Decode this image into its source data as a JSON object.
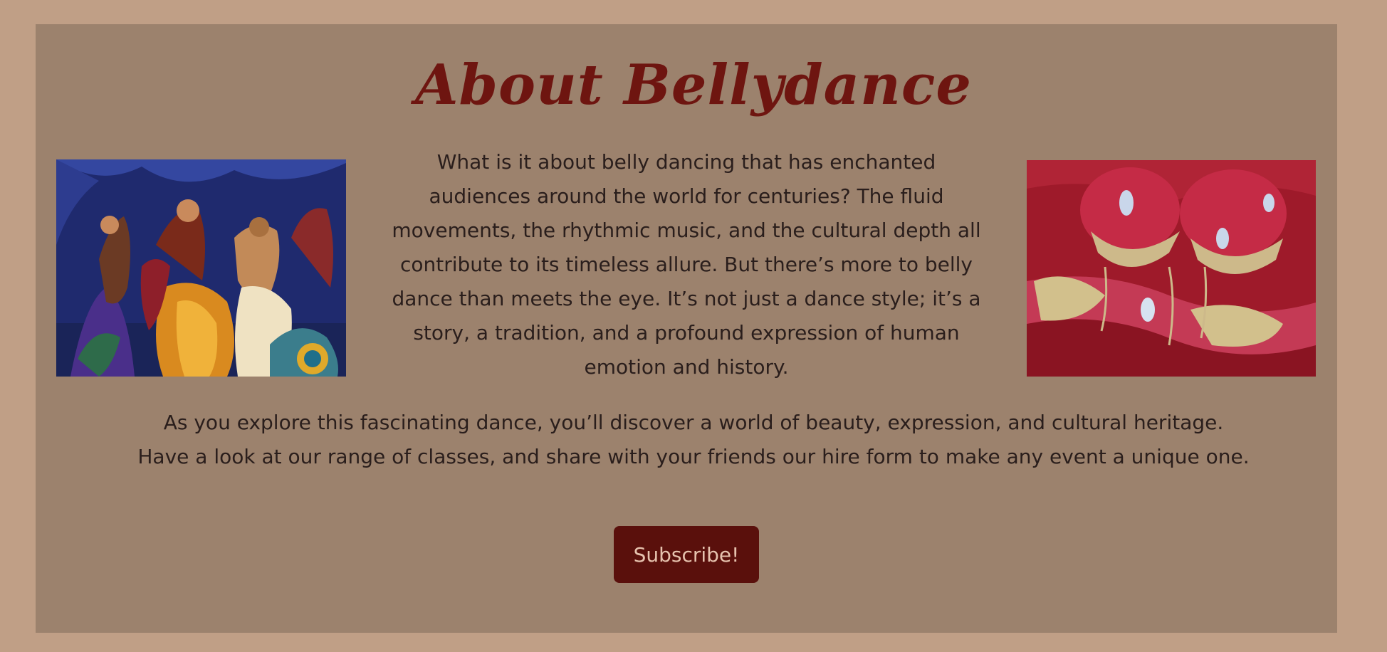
{
  "page": {
    "title": "About Bellydance",
    "intro_text": "What is it about belly dancing that has enchanted audiences around the world for centuries? The fluid movements, the rhythmic music, and the cultural depth all contribute to its timeless allure. But there’s more to belly dance than meets the eye. It’s not just a dance style; it’s a story, a tradition, and a profound expression of human emotion and history.",
    "outro_line1": "As you explore this fascinating dance, you’ll discover a world of beauty, expression, and cultural heritage.",
    "outro_line2": "Have a look at our range of classes, and share with your friends our hire form to make any event a unique one.",
    "subscribe_label": "Subscribe!"
  },
  "images": {
    "left": "painting of belly dancers",
    "right": "red jeweled belly dance costume"
  },
  "colors": {
    "outer_background": "#c09f86",
    "panel_background": "#9c826d",
    "title": "#6e1510",
    "body_text": "#2a1e1c",
    "button_background": "#5a100c",
    "button_text": "#e6c2ae"
  }
}
